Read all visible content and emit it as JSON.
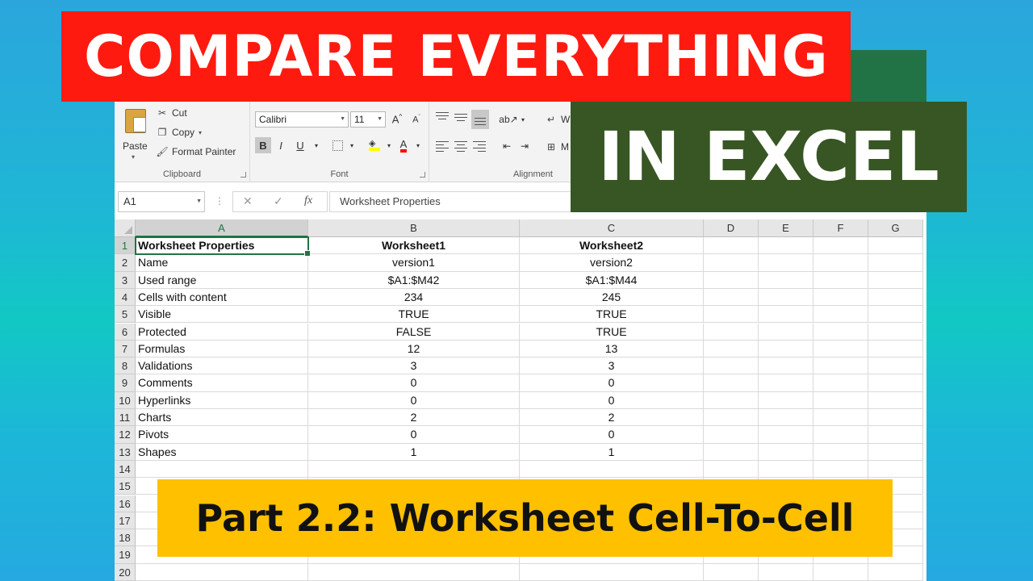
{
  "banners": {
    "title_top": "COMPARE EVERYTHING",
    "title_bottom": "IN EXCEL",
    "subtitle": "Part 2.2: Worksheet Cell-To-Cell"
  },
  "ribbon": {
    "clipboard": {
      "paste": "Paste",
      "cut": "Cut",
      "copy": "Copy",
      "format_painter": "Format Painter",
      "label": "Clipboard"
    },
    "font": {
      "name": "Calibri",
      "size": "11",
      "bold": "B",
      "italic": "I",
      "underline": "U",
      "label": "Font"
    },
    "alignment": {
      "wrap_partial": "W",
      "merge_partial": "M",
      "label": "Alignment"
    }
  },
  "formula_bar": {
    "name_box": "A1",
    "fx": "fx",
    "cancel": "✕",
    "enter": "✓",
    "content": "Worksheet Properties"
  },
  "sheet": {
    "columns": [
      "A",
      "B",
      "C",
      "D",
      "E",
      "F",
      "G"
    ],
    "rows": [
      {
        "n": "1",
        "a": "Worksheet Properties",
        "b": "Worksheet1",
        "c": "Worksheet2"
      },
      {
        "n": "2",
        "a": "Name",
        "b": "version1",
        "c": "version2"
      },
      {
        "n": "3",
        "a": "Used range",
        "b": "$A1:$M42",
        "c": "$A1:$M44"
      },
      {
        "n": "4",
        "a": "Cells with content",
        "b": "234",
        "c": "245"
      },
      {
        "n": "5",
        "a": "Visible",
        "b": "TRUE",
        "c": "TRUE"
      },
      {
        "n": "6",
        "a": "Protected",
        "b": "FALSE",
        "c": "TRUE"
      },
      {
        "n": "7",
        "a": "Formulas",
        "b": "12",
        "c": "13"
      },
      {
        "n": "8",
        "a": "Validations",
        "b": "3",
        "c": "3"
      },
      {
        "n": "9",
        "a": "Comments",
        "b": "0",
        "c": "0"
      },
      {
        "n": "10",
        "a": "Hyperlinks",
        "b": "0",
        "c": "0"
      },
      {
        "n": "11",
        "a": "Charts",
        "b": "2",
        "c": "2"
      },
      {
        "n": "12",
        "a": "Pivots",
        "b": "0",
        "c": "0"
      },
      {
        "n": "13",
        "a": "Shapes",
        "b": "1",
        "c": "1"
      },
      {
        "n": "14",
        "a": "",
        "b": "",
        "c": ""
      },
      {
        "n": "15",
        "a": "",
        "b": "",
        "c": ""
      },
      {
        "n": "16",
        "a": "",
        "b": "",
        "c": ""
      },
      {
        "n": "17",
        "a": "",
        "b": "",
        "c": ""
      },
      {
        "n": "18",
        "a": "",
        "b": "",
        "c": ""
      },
      {
        "n": "19",
        "a": "",
        "b": "",
        "c": ""
      },
      {
        "n": "20",
        "a": "",
        "b": "",
        "c": ""
      }
    ]
  },
  "colors": {
    "red_banner": "#ff1a10",
    "green_banner": "#375623",
    "yellow_banner": "#ffc000",
    "excel_green": "#217346"
  }
}
